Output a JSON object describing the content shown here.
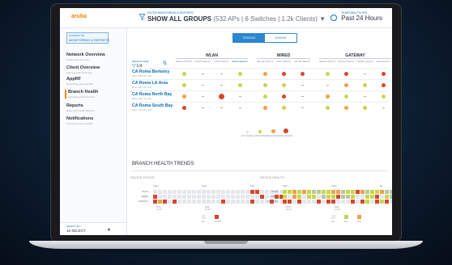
{
  "colors": {
    "accent": "#0b6fb6",
    "brand": "#ff8300",
    "good": "#c8d64a",
    "warn": "#f0a048",
    "bad": "#d8452c",
    "none": "#d9dde2"
  },
  "app": {
    "logo": "aruba",
    "section": "Central"
  },
  "header": {
    "filter_caption": "FILTER MONITORING & REPORTS",
    "filter_value": "SHOW ALL GROUPS",
    "filter_counts": "(532 APs | 6 Switches | 1.2k Clients) ▼",
    "time_caption": "TEMPORAL FILTER",
    "time_value": "Past 24 Hours",
    "filter_icon": "funnel-icon",
    "time_icon": "clock-icon"
  },
  "sidebar": {
    "context_caption": "CONTEXT OF",
    "context_value": "MONITORING & REPORTS",
    "items": [
      {
        "label": "Network Overview",
        "sub": "Single-view summary"
      },
      {
        "label": "Client Overview",
        "sub": "Client-specific summary"
      },
      {
        "label": "AppRF",
        "sub": "Something about AppRF"
      },
      {
        "label": "Branch Health",
        "sub": "Something about branch"
      },
      {
        "label": "Reports",
        "sub": "Basic and Create Reports"
      },
      {
        "label": "Notifications",
        "sub": "Something about AppRF"
      }
    ],
    "active_index": 3,
    "select_caption": "SELECT ALL",
    "select_value": "16 SELECT",
    "select_arrow": "▼"
  },
  "main": {
    "toggle": [
      "STATUS",
      "USAGE"
    ],
    "groups": [
      "WLAN",
      "WIRED",
      "GATEWAY"
    ],
    "site_header": {
      "caption": "BRANCH NAME",
      "count": "1/4",
      "filter_icon": "filter-icon"
    },
    "columns": [
      "DEVICE STATUS",
      "CLIENT HEALTH",
      "CONN HEALTH",
      "RADIO HEALTH",
      "DEVICE STATUS",
      "PORT HEALTH",
      "UPLINK HEALTH",
      "DEVICE STATUS",
      "UPLINK STATUS",
      "TUNNEL HEALTH",
      "WAN HEALTH"
    ],
    "radio_col_extra": "LOW",
    "rows": [
      {
        "name": "CA Roma Berkeley",
        "sub": "ROLL | SW | AP | GW",
        "cells": [
          "g",
          "-",
          "-",
          "g",
          "o",
          "r",
          "r",
          "g",
          "r",
          "-",
          "r"
        ]
      },
      {
        "name": "CA Roma LA Area",
        "sub": "ROLL | SW | AP | GW",
        "cells": [
          "g",
          "-",
          "-",
          "g",
          "g",
          "g",
          "-",
          "-",
          "o",
          "g",
          "r"
        ]
      },
      {
        "name": "CA Roma North Bay",
        "sub": "ROLL | SW | AP | GW",
        "cells": [
          "o",
          "-",
          "R",
          "-",
          "g",
          "r",
          "-",
          "o",
          "g",
          "-",
          "g"
        ]
      },
      {
        "name": "CA Roma South Bay",
        "sub": "ROLL | SW | AP | GW",
        "cells": [
          "r",
          "-",
          "-",
          "-",
          "o",
          "g",
          "-",
          "g",
          "o",
          "g",
          "-"
        ]
      }
    ],
    "legend": [
      {
        "label": "NO ISSUES",
        "kind": "none"
      },
      {
        "label": "LOW ISSUES",
        "kind": "good"
      },
      {
        "label": "MED ISSUES",
        "kind": "warn"
      },
      {
        "label": "HIGH ISSUES",
        "kind": "bad"
      }
    ],
    "trends_title": "BRANCH HEALTH TRENDS",
    "device_status": {
      "title": "DEVICE STATUS",
      "top_labels": [
        "12am",
        "12pm",
        "Now"
      ],
      "rows": [
        "WLAN",
        "WIRED",
        "GATEWAY"
      ],
      "axis": [
        "MON\nJul 16",
        "WED\nJul 18"
      ],
      "legend": [
        "UP",
        "DOWN"
      ],
      "grid": [
        "....................rr.....",
        "r.....................r..rr",
        "ror.r.........r.....r...r.."
      ]
    },
    "device_health": {
      "title": "DEVICE HEALTH",
      "top_labels": [
        "12am",
        "12pm",
        "No"
      ],
      "rows": [
        "WLAN",
        "WIRED",
        "GATEWAY"
      ],
      "axis": [
        "MON\nJul 16",
        "WED\nJul 18"
      ],
      "legend": [
        "OK",
        "Fair",
        "Poor"
      ],
      "grid": [
        "yyoyoyggyyoogyyrogyyoggogy",
        "y.oy.yy.gyyrggy..yyr.ygyyr",
        "rr.r...r.rr...r.ry.ryr..r."
      ]
    }
  }
}
